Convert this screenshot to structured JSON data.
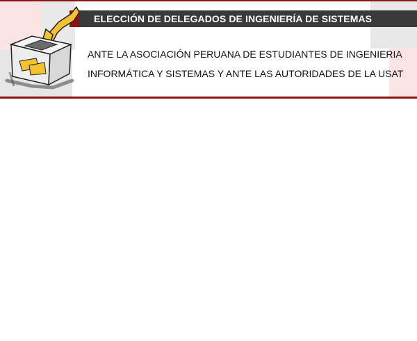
{
  "header": {
    "title": "ELECCIÓN DE DELEGADOS DE INGENIERÍA DE SISTEMAS",
    "subtitle_line1": "ANTE LA ASOCIACIÓN PERUANA DE ESTUDIANTES DE INGENIERIA",
    "subtitle_line2": "INFORMÁTICA Y SISTEMAS Y ANTE LAS AUTORIDADES DE LA USAT",
    "logo_icon": "ballot-box-icon"
  },
  "colors": {
    "accent": "#8a1414",
    "title_bar": "#3a3a3a",
    "ballot_yellow": "#f2c230",
    "tile_pink": "#fbe3e3",
    "tile_grey": "#e6e6e6"
  }
}
